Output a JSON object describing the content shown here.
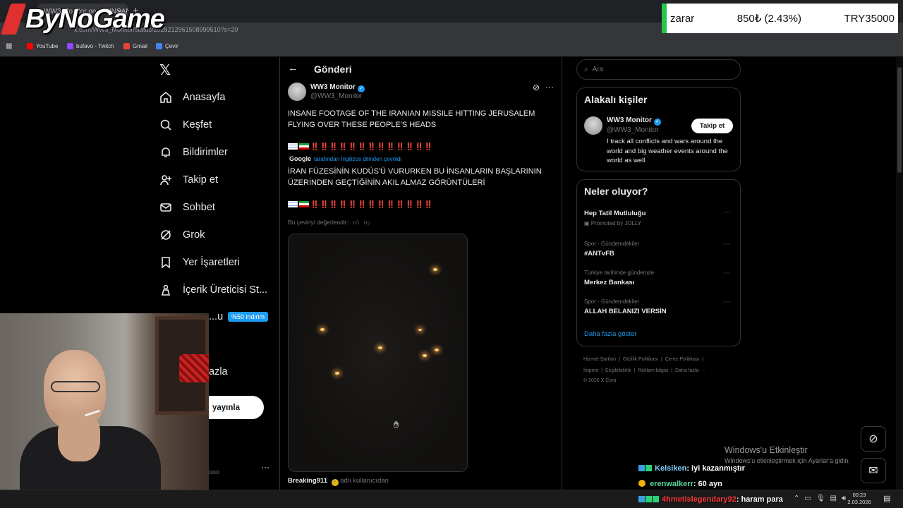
{
  "browser": {
    "tab_title": "WW3 Monitor on X: \"INSAN",
    "tab_close": "✕",
    "new_tab": "+",
    "url": "x.com/WW3_Monitor/status/2028212961508999510?s=20",
    "bookmarks": [
      {
        "label": "YouTube",
        "color": "#ff0000"
      },
      {
        "label": "bufavo - Twitch",
        "color": "#9146ff"
      },
      {
        "label": "Gmail",
        "color": "#ea4335"
      },
      {
        "label": "Çevir",
        "color": "#4285f4"
      }
    ]
  },
  "overlay": {
    "logo_text": "ByNoGame",
    "ticker": {
      "label": "zarar",
      "change": "850₺ (2.43%)",
      "total": "TRY35000",
      "accent": "#26c64b"
    }
  },
  "nav": {
    "items": [
      {
        "label": "Anasayfa"
      },
      {
        "label": "Keşfet"
      },
      {
        "label": "Bildirimler"
      },
      {
        "label": "Takip et"
      },
      {
        "label": "Sohbet"
      },
      {
        "label": "Grok"
      },
      {
        "label": "Yer İşaretleri"
      },
      {
        "label": "İçerik Üreticisi St..."
      }
    ],
    "premium_partial": "...u",
    "premium_badge": "%50 indirim",
    "more_partial": "azla",
    "post_button": "yayınla",
    "account_partial": "ooo",
    "account_more": "···"
  },
  "post": {
    "header_title": "Gönderi",
    "author_name": "WW3 Monitor",
    "author_handle": "@WW3_Monitor",
    "text_en": "INSANE FOOTAGE OF THE IRANIAN MISSILE HITTING JERUSALEM FLYING OVER THESE PEOPLE'S HEADS",
    "marks": "‼️‼️‼️‼️‼️‼️‼️‼️‼️‼️‼️‼️‼️",
    "google_label": "Google",
    "translated_from": "tarafından İngilizce dilinden çevrildi",
    "text_tr": "İRAN FÜZESİNİN KUDÜS'Ü VURURKEN BU İNSANLARIN BAŞLARININ ÜZERİNDEN GEÇTİĞİNİN AKIL ALMAZ GÖRÜNTÜLERİ",
    "rate_translation": "Bu çeviriyi değerlendir:",
    "quoted_name": "Breaking911",
    "quoted_suffix": "adlı kullanıcıdan"
  },
  "sidebar": {
    "search_placeholder": "Ara",
    "relevant_title": "Alakalı kişiler",
    "person_name": "WW3 Monitor",
    "person_handle": "@WW3_Monitor",
    "follow_label": "Takip et",
    "person_bio": "I track all conflicts and wars around the world and big weather events around the world as well",
    "trends_title": "Neler oluyor?",
    "trends": [
      {
        "category": "",
        "name": "Hep Tatil Mutluluğu",
        "promo": "Promoted by JOLLY"
      },
      {
        "category": "Spor · Gündemdekiler",
        "name": "#ANTvFB",
        "promo": ""
      },
      {
        "category": "Türkiye tarihinde gündemde",
        "name": "Merkez Bankası",
        "promo": ""
      },
      {
        "category": "Spor · Gündemdekiler",
        "name": "ALLAH BELANIZI VERSİN",
        "promo": ""
      }
    ],
    "show_more": "Daha fazla göster",
    "footer_row1": [
      "Hizmet Şartları",
      "Gizlilik Politikası",
      "Çerez Politikası"
    ],
    "footer_row2": [
      "Imprint",
      "Erişilebilirlik",
      "Reklam bilgisi",
      "Daha fazla ···"
    ],
    "copyright": "© 2026 X Corp."
  },
  "windows": {
    "activate_title": "Windows'u Etkinleştir",
    "activate_sub": "Windows'u etkinleştirmek için Ayarlar'a gidin.",
    "time": "00:23",
    "date": "2.03.2026"
  },
  "chat": [
    {
      "user": "Kelsiken",
      "message": ": iyi kazanmıştır"
    },
    {
      "user": "erenwalkerr",
      "message": ": 60 ayn"
    },
    {
      "user": "4hmetislegendary92",
      "message": ": haram para"
    }
  ]
}
